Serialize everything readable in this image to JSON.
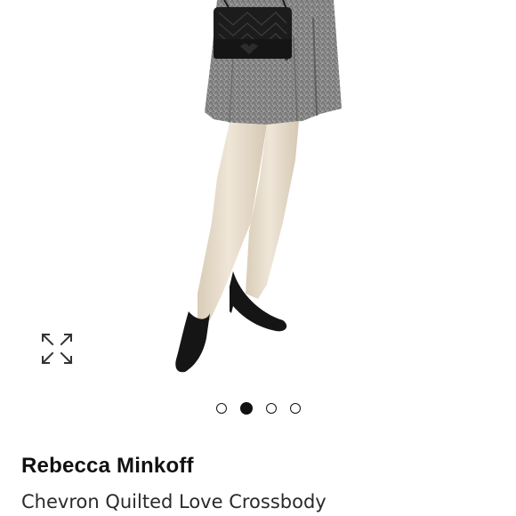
{
  "product": {
    "brand": "Rebecca Minkoff",
    "name": "Chevron Quilted Love Crossbody"
  },
  "gallery": {
    "total_images": 4,
    "active_index": 1
  },
  "icons": {
    "expand": "expand-arrows-icon"
  },
  "colors": {
    "text": "#111111",
    "dress": "#8a8a8a",
    "bag": "#1c1c1c",
    "shoe": "#151515",
    "tights": "#e8dccb"
  }
}
